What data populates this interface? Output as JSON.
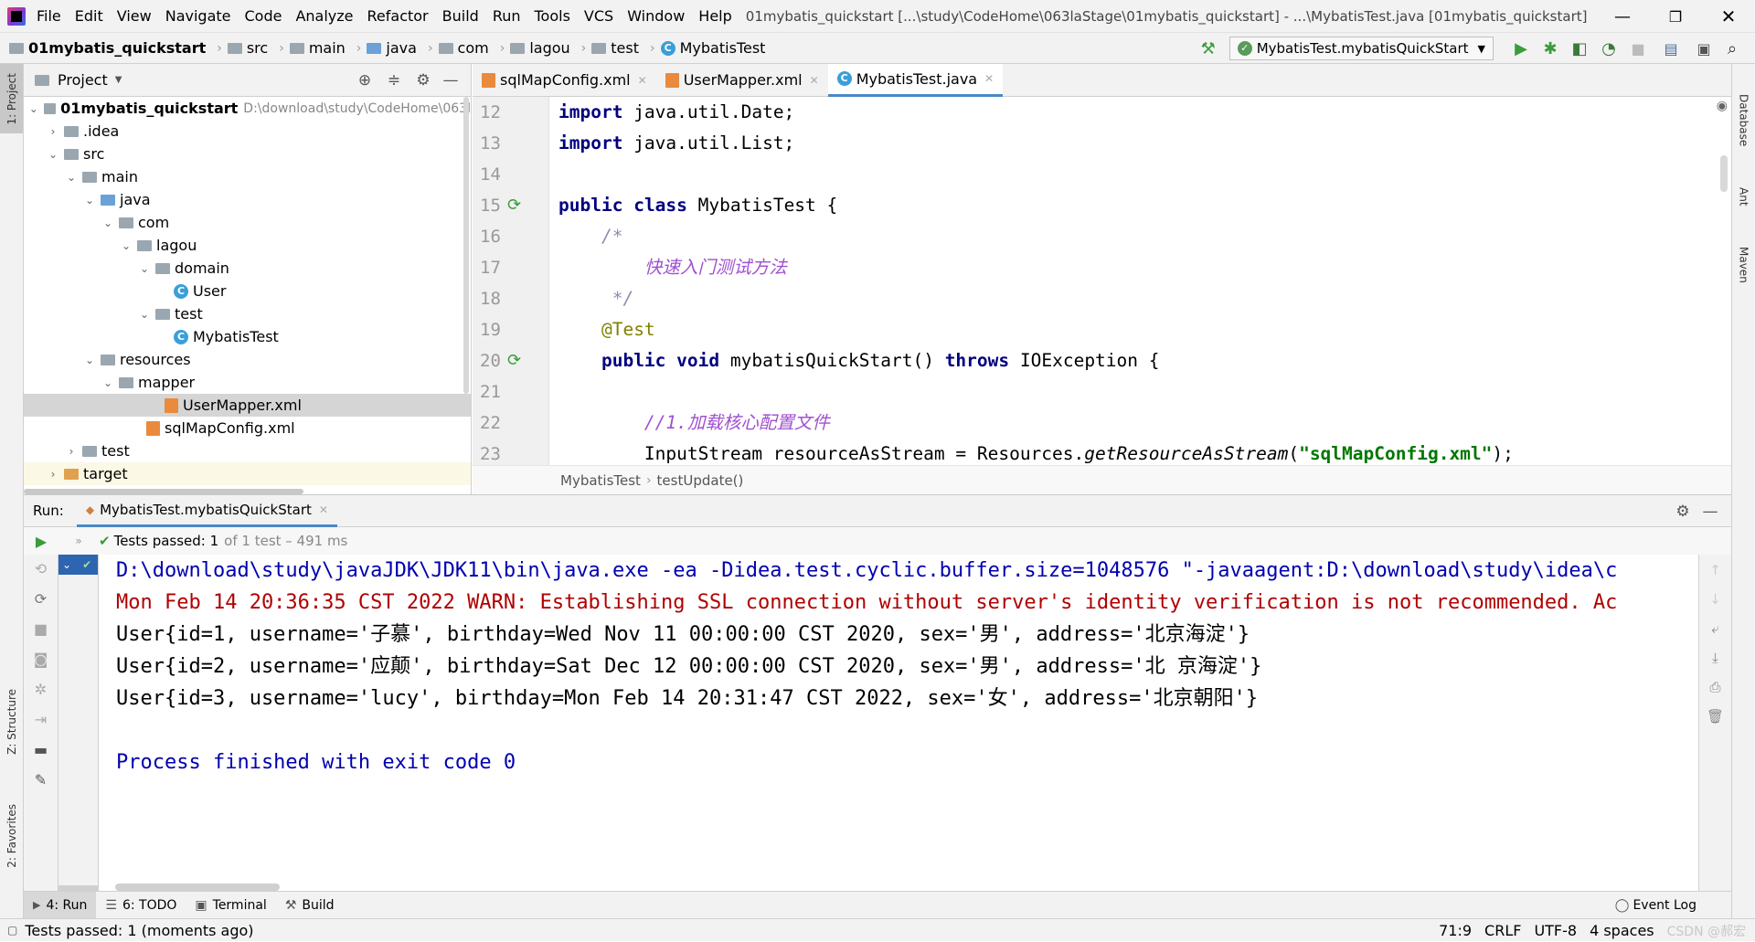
{
  "titlebar": {
    "menu": [
      "File",
      "Edit",
      "View",
      "Navigate",
      "Code",
      "Analyze",
      "Refactor",
      "Build",
      "Run",
      "Tools",
      "VCS",
      "Window",
      "Help"
    ],
    "title": "01mybatis_quickstart [...\\study\\CodeHome\\063laStage\\01mybatis_quickstart] - ...\\MybatisTest.java [01mybatis_quickstart]"
  },
  "navbar": {
    "crumbs": [
      "01mybatis_quickstart",
      "src",
      "main",
      "java",
      "com",
      "lagou",
      "test",
      "MybatisTest"
    ],
    "run_config": "MybatisTest.mybatisQuickStart"
  },
  "leftstrip": {
    "project": "1: Project",
    "structure": "Z: Structure",
    "favorites": "2: Favorites"
  },
  "rightstrip": {
    "database": "Database",
    "ant": "Ant",
    "maven": "Maven"
  },
  "project": {
    "title": "Project",
    "items": [
      {
        "label": "01mybatis_quickstart",
        "path": "D:\\download\\study\\CodeHome\\063l"
      },
      {
        "label": ".idea"
      },
      {
        "label": "src"
      },
      {
        "label": "main"
      },
      {
        "label": "java"
      },
      {
        "label": "com"
      },
      {
        "label": "lagou"
      },
      {
        "label": "domain"
      },
      {
        "label": "User"
      },
      {
        "label": "test"
      },
      {
        "label": "MybatisTest"
      },
      {
        "label": "resources"
      },
      {
        "label": "mapper"
      },
      {
        "label": "UserMapper.xml"
      },
      {
        "label": "sqlMapConfig.xml"
      },
      {
        "label": "test"
      },
      {
        "label": "target"
      }
    ]
  },
  "tabs": [
    {
      "label": "sqlMapConfig.xml"
    },
    {
      "label": "UserMapper.xml"
    },
    {
      "label": "MybatisTest.java"
    }
  ],
  "editor": {
    "lines": [
      "12",
      "13",
      "14",
      "15",
      "16",
      "17",
      "18",
      "19",
      "20",
      "21",
      "22",
      "23"
    ],
    "code": {
      "l12_kw": "import",
      "l12": " java.util.Date;",
      "l13_kw": "import",
      "l13": " java.util.List;",
      "l15_kw1": "public",
      "l15_kw2": "class",
      "l15": " MybatisTest {",
      "l16": "/*",
      "l17": "快速入门测试方法",
      "l18": " */",
      "l19": "@Test",
      "l20_kw1": "public",
      "l20_kw2": "void",
      "l20a": " mybatisQuickStart() ",
      "l20_kw3": "throws",
      "l20b": " IOException {",
      "l22": "//1.加载核心配置文件",
      "l23a": "InputStream resourceAsStream = Resources.",
      "l23_it": "getResourceAsStream",
      "l23_b": "(",
      "l23_str": "\"sqlMapConfig.xml\"",
      "l23_c": ");"
    },
    "breadcrumb": [
      "MybatisTest",
      "testUpdate()"
    ]
  },
  "run": {
    "label": "Run:",
    "tab": "MybatisTest.mybatisQuickStart",
    "tests_passed": "Tests passed: 1",
    "tests_detail": "of 1 test – 491 ms",
    "console": [
      "D:\\download\\study\\javaJDK\\JDK11\\bin\\java.exe -ea -Didea.test.cyclic.buffer.size=1048576 \"-javaagent:D:\\download\\study\\idea\\c",
      "Mon Feb 14 20:36:35 CST 2022 WARN: Establishing SSL connection without server's identity verification is not recommended. Ac",
      "User{id=1, username='子慕', birthday=Wed Nov 11 00:00:00 CST 2020, sex='男', address='北京海淀'}",
      "User{id=2, username='应颠', birthday=Sat Dec 12 00:00:00 CST 2020, sex='男', address='北 京海淀'}",
      "User{id=3, username='lucy', birthday=Mon Feb 14 20:31:47 CST 2022, sex='女', address='北京朝阳'}",
      "",
      "Process finished with exit code 0"
    ]
  },
  "bottombar": {
    "run": "4: Run",
    "todo": "6: TODO",
    "terminal": "Terminal",
    "build": "Build",
    "event_log": "Event Log"
  },
  "status": {
    "message": "Tests passed: 1 (moments ago)",
    "position": "71:9",
    "line_sep": "CRLF",
    "encoding": "UTF-8",
    "indent": "4 spaces",
    "watermark": "CSDN @郝宏"
  }
}
